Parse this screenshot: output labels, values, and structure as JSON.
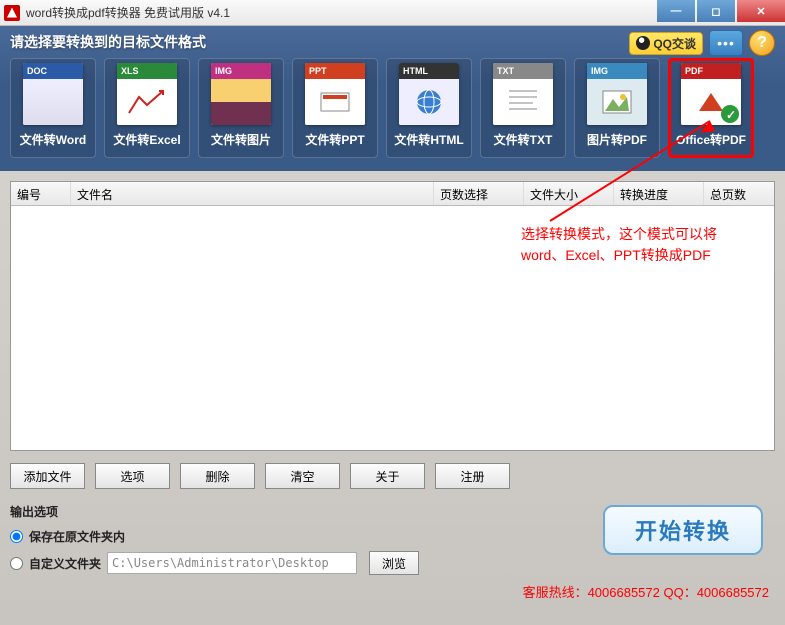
{
  "title": "word转换成pdf转换器 免费试用版 v4.1",
  "header": {
    "prompt": "请选择要转换到的目标文件格式",
    "qq_label": "QQ交谈"
  },
  "formats": [
    {
      "band": "DOC",
      "label": "文件转Word"
    },
    {
      "band": "XLS",
      "label": "文件转Excel"
    },
    {
      "band": "IMG",
      "label": "文件转图片"
    },
    {
      "band": "PPT",
      "label": "文件转PPT"
    },
    {
      "band": "HTML",
      "label": "文件转HTML"
    },
    {
      "band": "TXT",
      "label": "文件转TXT"
    },
    {
      "band": "IMG",
      "label": "图片转PDF"
    },
    {
      "band": "PDF",
      "label": "Office转PDF"
    }
  ],
  "table": {
    "cols": [
      "编号",
      "文件名",
      "页数选择",
      "文件大小",
      "转换进度",
      "总页数"
    ]
  },
  "annotation": {
    "line1": "选择转换模式，这个模式可以将",
    "line2": "word、Excel、PPT转换成PDF"
  },
  "buttons": {
    "add": "添加文件",
    "options": "选项",
    "delete": "删除",
    "clear": "清空",
    "about": "关于",
    "register": "注册"
  },
  "output": {
    "section_title": "输出选项",
    "radio_same": "保存在原文件夹内",
    "radio_custom": "自定义文件夹",
    "path": "C:\\Users\\Administrator\\Desktop",
    "browse": "浏览"
  },
  "start_label": "开始转换",
  "hotline": "客服热线：4006685572 QQ：4006685572"
}
